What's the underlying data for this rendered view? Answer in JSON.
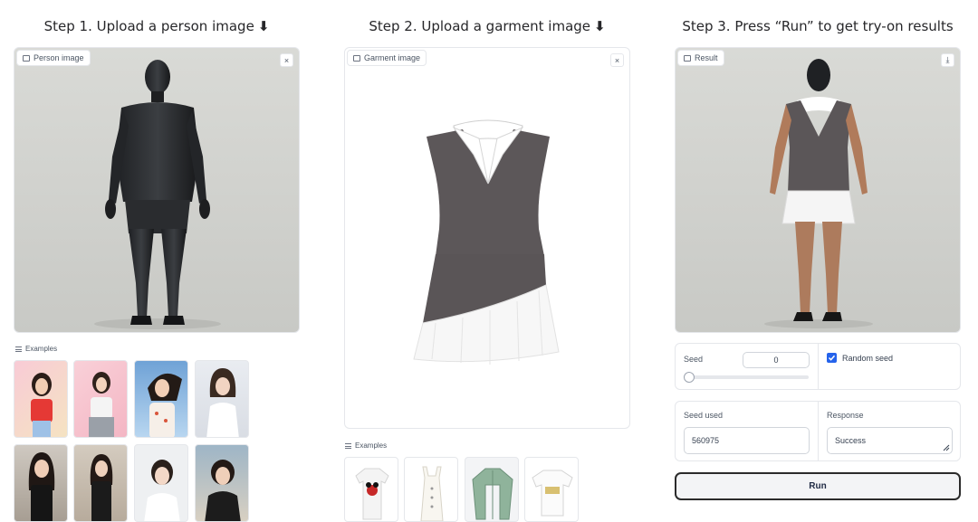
{
  "steps": {
    "step1": "Step 1. Upload a person image",
    "step2": "Step 2. Upload a garment image",
    "step3": "Step 3. Press “Run” to get try-on results",
    "arrow": "⬇"
  },
  "person_panel": {
    "label": "Person image",
    "close": "×"
  },
  "garment_panel": {
    "label": "Garment image",
    "close": "×"
  },
  "result_panel": {
    "label": "Result",
    "download": "⤓"
  },
  "person_examples": {
    "label": "Examples",
    "count": 8
  },
  "garment_examples": {
    "label": "Examples",
    "count": 4
  },
  "controls": {
    "seed_label": "Seed",
    "seed_value": "0",
    "seed_slider_level": 0,
    "random_seed_label": "Random seed",
    "random_seed_checked": true,
    "seed_used_label": "Seed used",
    "seed_used_value": "560975",
    "response_label": "Response",
    "response_value": "Success",
    "run_label": "Run"
  },
  "colors": {
    "accent": "#2563eb",
    "panel_bg": "#d4d5d1",
    "border": "#e5e7eb"
  }
}
